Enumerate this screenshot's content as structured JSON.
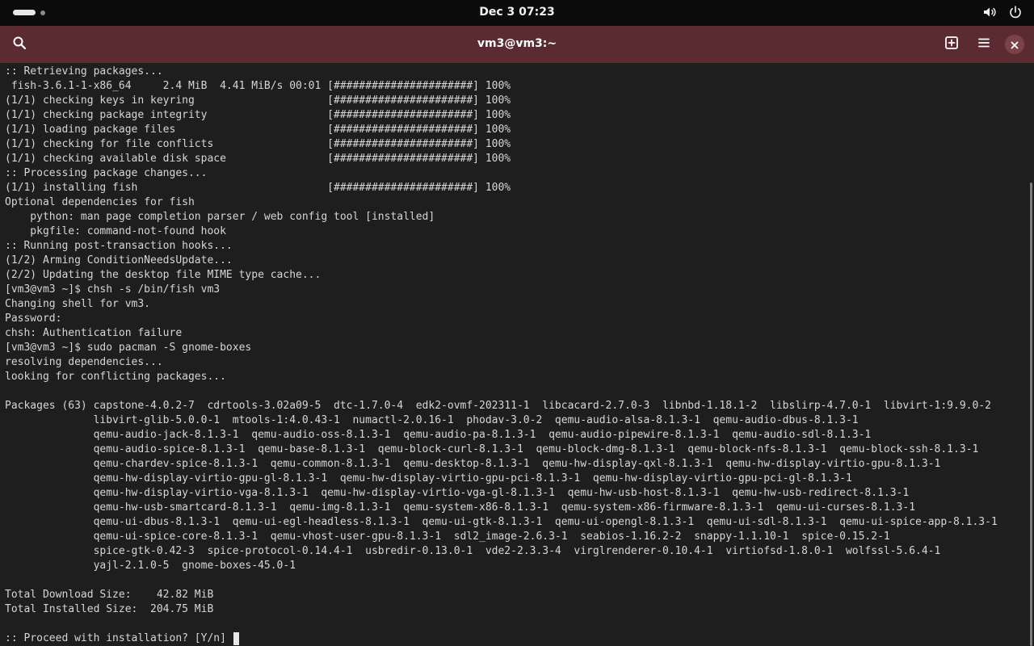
{
  "topbar": {
    "clock": "Dec 3  07:23",
    "icons": [
      "activities-indicator",
      "volume-icon",
      "power-icon"
    ]
  },
  "window": {
    "title": "vm3@vm3:~",
    "header_color": "#5b2b32",
    "icons": [
      "search-icon",
      "new-tab-icon",
      "menu-icon",
      "close-icon"
    ]
  },
  "terminal": {
    "lines": [
      ":: Retrieving packages...",
      " fish-3.6.1-1-x86_64     2.4 MiB  4.41 MiB/s 00:01 [######################] 100%",
      "(1/1) checking keys in keyring                     [######################] 100%",
      "(1/1) checking package integrity                   [######################] 100%",
      "(1/1) loading package files                        [######################] 100%",
      "(1/1) checking for file conflicts                  [######################] 100%",
      "(1/1) checking available disk space                [######################] 100%",
      ":: Processing package changes...",
      "(1/1) installing fish                              [######################] 100%",
      "Optional dependencies for fish",
      "    python: man page completion parser / web config tool [installed]",
      "    pkgfile: command-not-found hook",
      ":: Running post-transaction hooks...",
      "(1/2) Arming ConditionNeedsUpdate...",
      "(2/2) Updating the desktop file MIME type cache...",
      "[vm3@vm3 ~]$ chsh -s /bin/fish vm3",
      "Changing shell for vm3.",
      "Password:",
      "chsh: Authentication failure",
      "[vm3@vm3 ~]$ sudo pacman -S gnome-boxes",
      "resolving dependencies...",
      "looking for conflicting packages...",
      "",
      "Packages (63) capstone-4.0.2-7  cdrtools-3.02a09-5  dtc-1.7.0-4  edk2-ovmf-202311-1  libcacard-2.7.0-3  libnbd-1.18.1-2  libslirp-4.7.0-1  libvirt-1:9.9.0-2",
      "              libvirt-glib-5.0.0-1  mtools-1:4.0.43-1  numactl-2.0.16-1  phodav-3.0-2  qemu-audio-alsa-8.1.3-1  qemu-audio-dbus-8.1.3-1",
      "              qemu-audio-jack-8.1.3-1  qemu-audio-oss-8.1.3-1  qemu-audio-pa-8.1.3-1  qemu-audio-pipewire-8.1.3-1  qemu-audio-sdl-8.1.3-1",
      "              qemu-audio-spice-8.1.3-1  qemu-base-8.1.3-1  qemu-block-curl-8.1.3-1  qemu-block-dmg-8.1.3-1  qemu-block-nfs-8.1.3-1  qemu-block-ssh-8.1.3-1",
      "              qemu-chardev-spice-8.1.3-1  qemu-common-8.1.3-1  qemu-desktop-8.1.3-1  qemu-hw-display-qxl-8.1.3-1  qemu-hw-display-virtio-gpu-8.1.3-1",
      "              qemu-hw-display-virtio-gpu-gl-8.1.3-1  qemu-hw-display-virtio-gpu-pci-8.1.3-1  qemu-hw-display-virtio-gpu-pci-gl-8.1.3-1",
      "              qemu-hw-display-virtio-vga-8.1.3-1  qemu-hw-display-virtio-vga-gl-8.1.3-1  qemu-hw-usb-host-8.1.3-1  qemu-hw-usb-redirect-8.1.3-1",
      "              qemu-hw-usb-smartcard-8.1.3-1  qemu-img-8.1.3-1  qemu-system-x86-8.1.3-1  qemu-system-x86-firmware-8.1.3-1  qemu-ui-curses-8.1.3-1",
      "              qemu-ui-dbus-8.1.3-1  qemu-ui-egl-headless-8.1.3-1  qemu-ui-gtk-8.1.3-1  qemu-ui-opengl-8.1.3-1  qemu-ui-sdl-8.1.3-1  qemu-ui-spice-app-8.1.3-1",
      "              qemu-ui-spice-core-8.1.3-1  qemu-vhost-user-gpu-8.1.3-1  sdl2_image-2.6.3-1  seabios-1.16.2-2  snappy-1.1.10-1  spice-0.15.2-1",
      "              spice-gtk-0.42-3  spice-protocol-0.14.4-1  usbredir-0.13.0-1  vde2-2.3.3-4  virglrenderer-0.10.4-1  virtiofsd-1.8.0-1  wolfssl-5.6.4-1",
      "              yajl-2.1.0-5  gnome-boxes-45.0-1",
      "",
      "Total Download Size:    42.82 MiB",
      "Total Installed Size:  204.75 MiB",
      ""
    ],
    "prompt": ":: Proceed with installation? [Y/n] "
  }
}
